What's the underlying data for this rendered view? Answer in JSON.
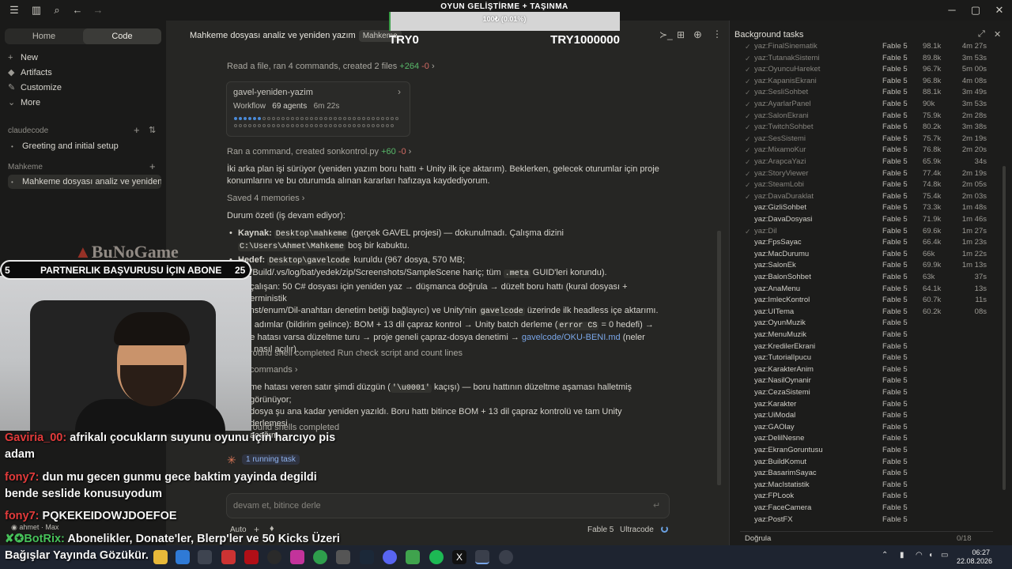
{
  "window": {
    "nav": {
      "home": "Home",
      "code": "Code"
    }
  },
  "sidebar": {
    "items": [
      {
        "icon": "+",
        "label": "New"
      },
      {
        "icon": "◆",
        "label": "Artifacts"
      },
      {
        "icon": "✎",
        "label": "Customize"
      },
      {
        "icon": "⌄",
        "label": "More"
      }
    ],
    "section1": "claudecode",
    "section1_item": "Greeting and initial setup",
    "section2": "Mahkeme",
    "section2_item": "Mahkeme dosyası analiz ve yeniden yaz"
  },
  "main": {
    "title": "Mahkeme dosyası analiz ve yeniden yazım",
    "title_chip": "Mahkeme",
    "step1": "Read a file, ran 4 commands, created 2 files",
    "step1_add": "+264",
    "step1_del": "-0",
    "workflow": {
      "name": "gavel-yeniden-yazim",
      "label": "Workflow",
      "agents": "69 agents",
      "time": "6m 22s"
    },
    "step2": "Ran a command, created sonkontrol.py",
    "step2_add": "+60",
    "step2_del": "-0",
    "para1": "İki arka plan işi sürüyor (yeniden yazım boru hattı + Unity ilk içe aktarım). Beklerken, gelecek oturumlar için proje konumlarını ve bu oturumda alınan kararları hafızaya kaydediyorum.",
    "memories": "Saved 4 memories",
    "summary_title": "Durum özeti (iş devam ediyor):",
    "b1_key": "Kaynak:",
    "b1_code": "Desktop\\mahkeme",
    "b1_text": "(gerçek GAVEL projesi) — dokunulmadı. Çalışma dizini",
    "b1_code2": "C:\\Users\\Ahmet\\Mahkeme",
    "b1_tail": "boş bir kabuktu.",
    "b2_key": "Hedef:",
    "b2_code": "Desktop\\gavelcode",
    "b2_text": "kuruldu (967 dosya, 570 MB;",
    "b2_line2": "ary/Build/.vs/log/bat/yedek/zip/Screenshots/SampleScene hariç; tüm",
    "b2_code2": ".meta",
    "b2_tail": "GUID'leri korundu).",
    "b3_text": "an çalışan: 50 C# dosyası için yeniden yaz → düşmanca doğrula → düzelt boru hattı (kural dosyası + deterministik",
    "b3_line2": "/const/enum/Dil-anahtarı denetim betiği bağlayıcı) ve Unity'nin",
    "b3_code": "gavelcode",
    "b3_tail": "üzerinde ilk headless içe aktarımı.",
    "b4_text": "raki adımlar (bildirim gelince): BOM + 13 dil çapraz kontrol → Unity batch derleme (",
    "b4_code": "error CS",
    "b4_text2": "= 0 hedefi) →",
    "b4_line2": "eme hatası varsa düzeltme turu → proje geneli çapraz-dosya denetimi →",
    "b4_link": "gavelcode/OKU-BENI.md",
    "b4_tail": "(neler",
    "b4_line3": "iştı, nasıl açılır).",
    "bg1": "round shell completed  Run check script and count lines",
    "commands": "commands",
    "para2a": "me hatası veren satır şimdi düzgün (",
    "para2_code": "'\\u0001'",
    "para2b": "kaçışı) — boru hattının düzeltme aşaması halletmiş görünüyor;",
    "para2c": "dosya şu ana kadar yeniden yazıldı. Boru hattı bitince BOM + 13 dil çapraz kontrolü ve tam Unity derlemesi",
    "para2d": "acağım.",
    "bg2": "round shells completed",
    "running": "1 running task",
    "input_placeholder": "devam et, bitince derle",
    "footer": {
      "mode": "Auto",
      "model": "Fable 5",
      "effort": "Ultracode"
    }
  },
  "panel": {
    "title": "Background tasks",
    "tasks": [
      {
        "name": "yaz:FinalSinematik",
        "model": "Fable 5",
        "size": "98.1k",
        "time": "4m 27s",
        "done": true
      },
      {
        "name": "yaz:TutanakSistemi",
        "model": "Fable 5",
        "size": "89.8k",
        "time": "3m 53s",
        "done": true
      },
      {
        "name": "yaz:OyuncuHareket",
        "model": "Fable 5",
        "size": "96.7k",
        "time": "5m 00s",
        "done": true
      },
      {
        "name": "yaz:KapanisEkrani",
        "model": "Fable 5",
        "size": "96.8k",
        "time": "4m 08s",
        "done": true
      },
      {
        "name": "yaz:SesliSohbet",
        "model": "Fable 5",
        "size": "88.1k",
        "time": "3m 49s",
        "done": true
      },
      {
        "name": "yaz:AyarlarPanel",
        "model": "Fable 5",
        "size": "90k",
        "time": "3m 53s",
        "done": true
      },
      {
        "name": "yaz:SalonEkrani",
        "model": "Fable 5",
        "size": "75.9k",
        "time": "2m 28s",
        "done": true
      },
      {
        "name": "yaz:TwitchSohbet",
        "model": "Fable 5",
        "size": "80.2k",
        "time": "3m 38s",
        "done": true
      },
      {
        "name": "yaz:SesSistemi",
        "model": "Fable 5",
        "size": "75.7k",
        "time": "2m 19s",
        "done": true
      },
      {
        "name": "yaz:MixamoKur",
        "model": "Fable 5",
        "size": "76.8k",
        "time": "2m 20s",
        "done": true
      },
      {
        "name": "yaz:ArapcaYazi",
        "model": "Fable 5",
        "size": "65.9k",
        "time": "34s",
        "done": true
      },
      {
        "name": "yaz:StoryViewer",
        "model": "Fable 5",
        "size": "77.4k",
        "time": "2m 19s",
        "done": true
      },
      {
        "name": "yaz:SteamLobi",
        "model": "Fable 5",
        "size": "74.8k",
        "time": "2m 05s",
        "done": true
      },
      {
        "name": "yaz:DavaDuraklat",
        "model": "Fable 5",
        "size": "75.4k",
        "time": "2m 03s",
        "done": true
      },
      {
        "name": "yaz:GizliSohbet",
        "model": "Fable 5",
        "size": "73.3k",
        "time": "1m 48s",
        "done": false
      },
      {
        "name": "yaz:DavaDosyasi",
        "model": "Fable 5",
        "size": "71.9k",
        "time": "1m 46s",
        "done": false
      },
      {
        "name": "yaz:Dil",
        "model": "Fable 5",
        "size": "69.6k",
        "time": "1m 27s",
        "done": true
      },
      {
        "name": "yaz:FpsSayac",
        "model": "Fable 5",
        "size": "66.4k",
        "time": "1m 23s",
        "done": false
      },
      {
        "name": "yaz:MacDurumu",
        "model": "Fable 5",
        "size": "66k",
        "time": "1m 22s",
        "done": false
      },
      {
        "name": "yaz:SalonEk",
        "model": "Fable 5",
        "size": "69.9k",
        "time": "1m 13s",
        "done": false
      },
      {
        "name": "yaz:BalonSohbet",
        "model": "Fable 5",
        "size": "63k",
        "time": "37s",
        "done": false
      },
      {
        "name": "yaz:AnaMenu",
        "model": "Fable 5",
        "size": "64.1k",
        "time": "13s",
        "done": false
      },
      {
        "name": "yaz:ImlecKontrol",
        "model": "Fable 5",
        "size": "60.7k",
        "time": "11s",
        "done": false
      },
      {
        "name": "yaz:UITema",
        "model": "Fable 5",
        "size": "60.2k",
        "time": "08s",
        "done": false
      },
      {
        "name": "yaz:OyunMuzik",
        "model": "Fable 5",
        "size": "",
        "time": "",
        "done": false
      },
      {
        "name": "yaz:MenuMuzik",
        "model": "Fable 5",
        "size": "",
        "time": "",
        "done": false
      },
      {
        "name": "yaz:KredilerEkrani",
        "model": "Fable 5",
        "size": "",
        "time": "",
        "done": false
      },
      {
        "name": "yaz:TutorialIpucu",
        "model": "Fable 5",
        "size": "",
        "time": "",
        "done": false
      },
      {
        "name": "yaz:KarakterAnim",
        "model": "Fable 5",
        "size": "",
        "time": "",
        "done": false
      },
      {
        "name": "yaz:NasilOynanir",
        "model": "Fable 5",
        "size": "",
        "time": "",
        "done": false
      },
      {
        "name": "yaz:CezaSistemi",
        "model": "Fable 5",
        "size": "",
        "time": "",
        "done": false
      },
      {
        "name": "yaz:Karakter",
        "model": "Fable 5",
        "size": "",
        "time": "",
        "done": false
      },
      {
        "name": "yaz:UiModal",
        "model": "Fable 5",
        "size": "",
        "time": "",
        "done": false
      },
      {
        "name": "yaz:GAOlay",
        "model": "Fable 5",
        "size": "",
        "time": "",
        "done": false
      },
      {
        "name": "yaz:DelilNesne",
        "model": "Fable 5",
        "size": "",
        "time": "",
        "done": false
      },
      {
        "name": "yaz:EkranGoruntusu",
        "model": "Fable 5",
        "size": "",
        "time": "",
        "done": false
      },
      {
        "name": "yaz:BuildKomut",
        "model": "Fable 5",
        "size": "",
        "time": "",
        "done": false
      },
      {
        "name": "yaz:BasarimSayac",
        "model": "Fable 5",
        "size": "",
        "time": "",
        "done": false
      },
      {
        "name": "yaz:MacIstatistik",
        "model": "Fable 5",
        "size": "",
        "time": "",
        "done": false
      },
      {
        "name": "yaz:FPLook",
        "model": "Fable 5",
        "size": "",
        "time": "",
        "done": false
      },
      {
        "name": "yaz:FaceCamera",
        "model": "Fable 5",
        "size": "",
        "time": "",
        "done": false
      },
      {
        "name": "yaz:PostFX",
        "model": "Fable 5",
        "size": "",
        "time": "",
        "done": false
      }
    ],
    "group": "Doğrula",
    "group_count": "0/18"
  },
  "overlay": {
    "goal_title": "OYUN GELİŞTİRME + TAŞINMA",
    "goal_text": "100₺ (0.01%)",
    "goal_progress": 0.01,
    "goal_min": "TRY0",
    "goal_max": "TRY1000000",
    "brand": "BuNoGame",
    "abone_left": "5",
    "abone_text": "PARTNERLIK BAŞVURUSU İÇIN ABONE",
    "abone_right": "25",
    "chat": [
      {
        "user": "Gaviria_00:",
        "text": "afrikalı çocukların suyunu oyunu için harcıyo pis",
        "line2": "adam",
        "color": "#e23b3b"
      },
      {
        "user": "fony7:",
        "text": "dun mu gecen gunmu gece baktim yayinda degildi",
        "line2": "bende seslide konusuyodum",
        "color": "#e23b3b"
      },
      {
        "user": "fony7:",
        "text": "PQKEKEIDOWJDOEFOE",
        "line2": "",
        "color": "#e23b3b"
      }
    ],
    "user_small": "ahmet · Max",
    "bot_user": "BotRix:",
    "bot_line1": "Abonelikler, Donate'ler, Blerp'ler ve 50 Kicks Üzeri",
    "bot_line2": "Bağışlar Yayında Gözükür."
  },
  "taskbar": {
    "time": "06:27",
    "date": "22.08.2026"
  }
}
